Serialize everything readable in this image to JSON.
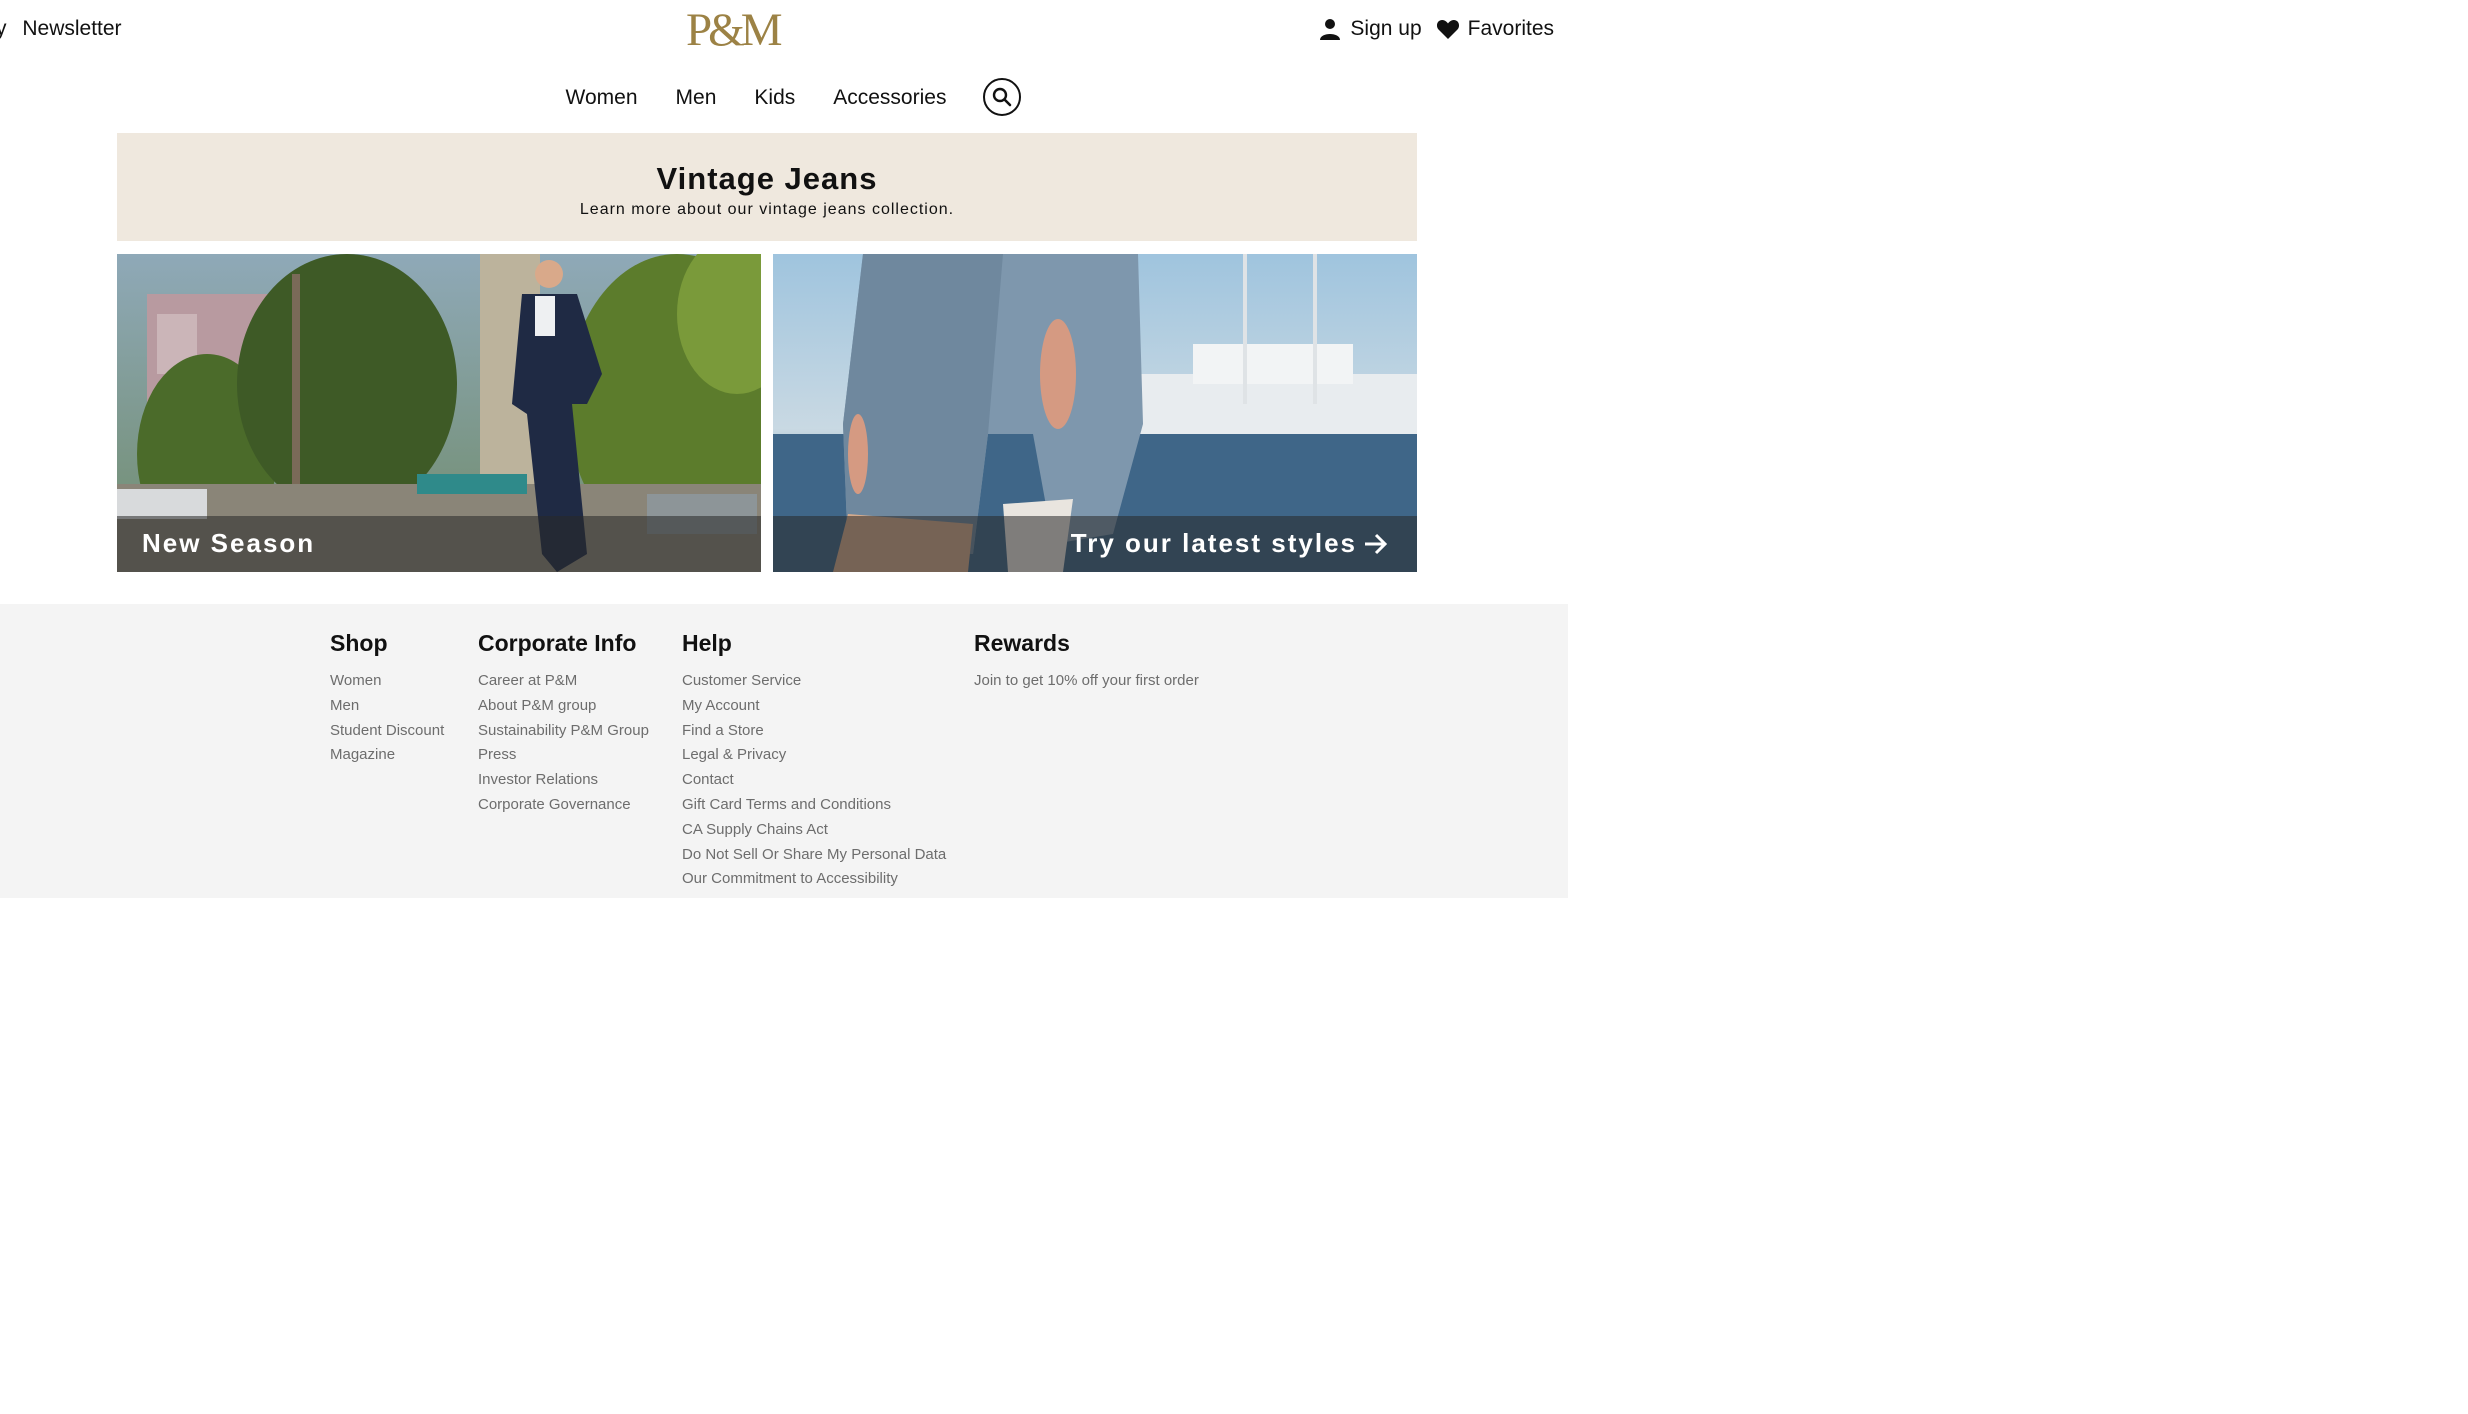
{
  "header": {
    "left_partial": "y",
    "newsletter": "Newsletter",
    "logo_text": "P&M",
    "sign_up": "Sign up",
    "favorites": "Favorites",
    "icons": {
      "user": "user-icon",
      "heart": "heart-icon",
      "search": "search-icon"
    }
  },
  "nav": {
    "items": [
      "Women",
      "Men",
      "Kids",
      "Accessories"
    ]
  },
  "banner": {
    "title": "Vintage Jeans",
    "subtitle": "Learn more about our vintage jeans collection."
  },
  "promos": {
    "left_caption": "New Season",
    "right_caption": "Try our latest styles"
  },
  "footer": {
    "shop": {
      "title": "Shop",
      "links": [
        "Women",
        "Men",
        "Student Discount",
        "Magazine"
      ]
    },
    "corporate": {
      "title": "Corporate Info",
      "links": [
        "Career at P&M",
        "About P&M group",
        "Sustainability P&M Group",
        "Press",
        "Investor Relations",
        "Corporate Governance"
      ]
    },
    "help": {
      "title": "Help",
      "links": [
        "Customer Service",
        "My Account",
        "Find a Store",
        "Legal & Privacy",
        "Contact",
        "Gift Card Terms and Conditions",
        "CA Supply Chains Act",
        "Do Not Sell Or Share My Personal Data",
        "Our Commitment to Accessibility"
      ]
    },
    "rewards": {
      "title": "Rewards",
      "text": "Join to get 10% off your first order"
    }
  },
  "colors": {
    "brand_gold": "#9c8245",
    "banner_bg": "#efe8de",
    "footer_bg": "#f4f4f4",
    "link_gray": "#6d6d6d"
  }
}
